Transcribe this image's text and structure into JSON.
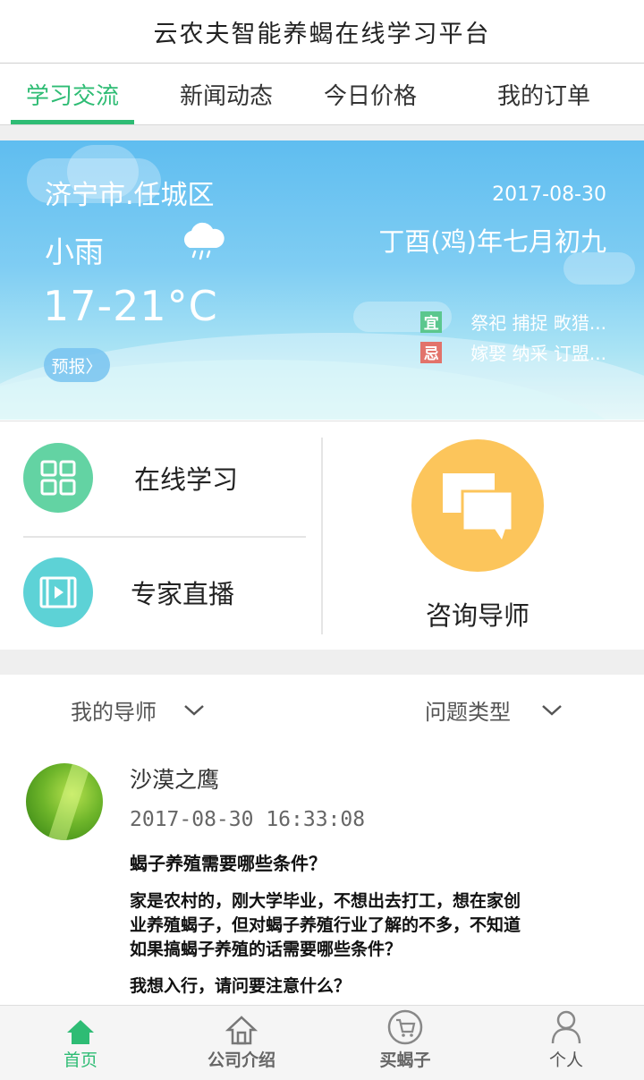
{
  "app": {
    "title": "云农夫智能养蝎在线学习平台"
  },
  "tabs": [
    {
      "label": "学习交流",
      "active": true
    },
    {
      "label": "新闻动态",
      "active": false
    },
    {
      "label": "今日价格",
      "active": false
    },
    {
      "label": "我的订单",
      "active": false
    }
  ],
  "weather": {
    "city": "济宁市.任城区",
    "condition": "小雨",
    "temperature": "17-21°C",
    "forecast_button": "预报〉",
    "date": "2017-08-30",
    "lunar_date": "丁酉(鸡)年七月初九",
    "suitable_tag": "宜",
    "suitable": "祭祀 捕捉 畋猎...",
    "avoid_tag": "忌",
    "avoid": "嫁娶 纳采 订盟...",
    "icon": "rain-cloud-icon",
    "colors": {
      "sky_top": "#5fbdf0",
      "suitable": "#5bc78e",
      "avoid": "#e2736b"
    }
  },
  "features": {
    "online_learning": {
      "label": "在线学习",
      "icon": "grid-icon",
      "color": "#63d3a3"
    },
    "expert_live": {
      "label": "专家直播",
      "icon": "video-icon",
      "color": "#5dd2d6"
    },
    "consult_tutor": {
      "label": "咨询导师",
      "icon": "chat-bubbles-icon",
      "color": "#fcc55b"
    }
  },
  "filters": {
    "tutor": "我的导师",
    "question_type": "问题类型"
  },
  "post": {
    "username": "沙漠之鹰",
    "timestamp": "2017-08-30 16:33:08",
    "question": "蝎子养殖需要哪些条件？",
    "body_lines": [
      "家是农村的，刚大学毕业，不想出去打工，想在家创",
      "业养殖蝎子，但对蝎子养殖行业了解的不多，不知道",
      "如果搞蝎子养殖的话需要哪些条件？"
    ],
    "extra": "我想入行，请问要注意什么？"
  },
  "bottom_nav": [
    {
      "label": "首页",
      "icon": "home-icon",
      "active": true
    },
    {
      "label": "公司介绍",
      "icon": "company-icon",
      "active": false
    },
    {
      "label": "买蝎子",
      "icon": "cart-icon",
      "active": false
    },
    {
      "label": "个人",
      "icon": "person-icon",
      "active": false
    }
  ],
  "colors": {
    "accent": "#2ebc74"
  }
}
